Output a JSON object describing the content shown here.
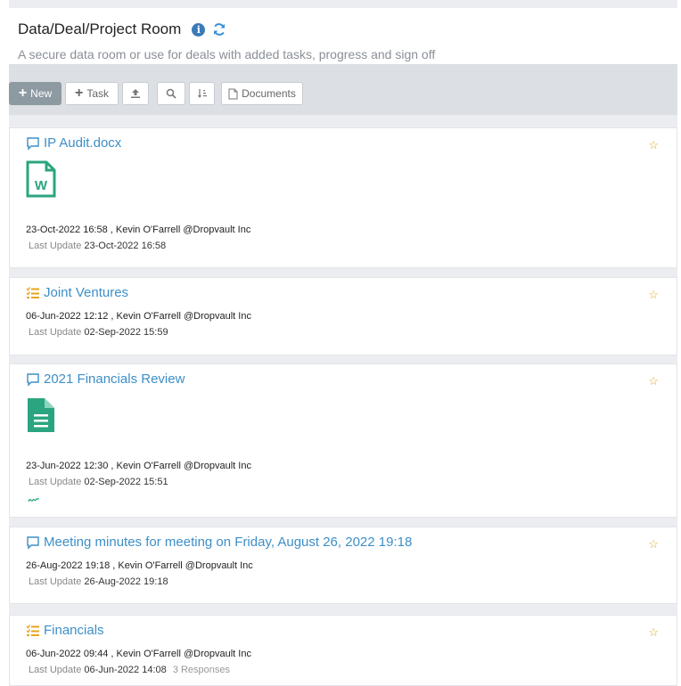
{
  "header": {
    "title": "Data/Deal/Project Room",
    "info_icon": "i",
    "subtitle": "A secure data room or use for deals with added tasks, progress and sign off"
  },
  "toolbar": {
    "new_label": "New",
    "task_label": "Task",
    "documents_label": "Documents",
    "plus_glyph": "+",
    "search_glyph": "⌕",
    "sort_glyph": "↓↕"
  },
  "items": [
    {
      "title": "IP Audit.docx",
      "icon": "comment-icon",
      "doc_letter": "W",
      "created": "23-Oct-2022 16:58 , Kevin O'Farrell @Dropvault Inc",
      "last_update_label": "Last Update",
      "last_update": "23-Oct-2022 16:58"
    },
    {
      "title": "Joint Ventures",
      "icon": "task-list-icon",
      "created": "06-Jun-2022 12:12 , Kevin O'Farrell @Dropvault Inc",
      "last_update_label": "Last Update",
      "last_update": "02-Sep-2022 15:59"
    },
    {
      "title": "2021 Financials Review",
      "icon": "comment-icon",
      "created": "23-Jun-2022 12:30 , Kevin O'Farrell @Dropvault Inc",
      "last_update_label": "Last Update",
      "last_update": "02-Sep-2022 15:51",
      "signature": "~"
    },
    {
      "title": "Meeting minutes for meeting on Friday, August 26, 2022 19:18",
      "icon": "comment-icon",
      "created": "26-Aug-2022 19:18 , Kevin O'Farrell @Dropvault Inc",
      "last_update_label": "Last Update",
      "last_update": "26-Aug-2022 19:18"
    },
    {
      "title": "Financials",
      "icon": "task-list-icon",
      "created": "06-Jun-2022 09:44 , Kevin O'Farrell @Dropvault Inc",
      "last_update_label": "Last Update",
      "last_update": "06-Jun-2022 14:08",
      "responses": "3 Responses"
    }
  ],
  "star_glyph": "☆",
  "colors": {
    "accent": "#3d8fc8",
    "star": "#e7a51f",
    "doc_green": "#2aa57f",
    "new_button": "#8e9aa2"
  }
}
